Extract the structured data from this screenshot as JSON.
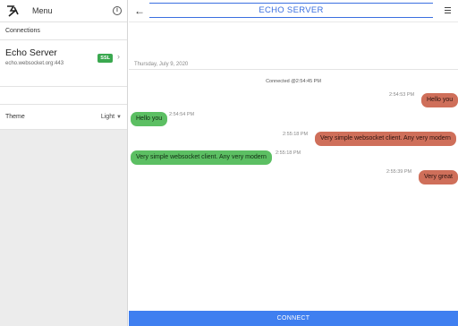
{
  "sidebar": {
    "menu_label": "Menu",
    "connections_label": "Connections",
    "connection": {
      "name": "Echo Server",
      "host": "echo.websocket.org:443",
      "badge": "SSL"
    },
    "theme": {
      "label": "Theme",
      "value": "Light"
    }
  },
  "header": {
    "title": "ECHO SERVER"
  },
  "chat": {
    "date": "Thursday, July 9, 2020",
    "status": "Connected @2:54:45 PM",
    "messages": [
      {
        "direction": "out",
        "text": "Hello you",
        "time": "2:54:53 PM"
      },
      {
        "direction": "in",
        "text": "Hello you",
        "time": "2:54:54 PM"
      },
      {
        "direction": "out",
        "text": "Very simple websocket client. Any very modern",
        "time": "2:55:18 PM"
      },
      {
        "direction": "in",
        "text": "Very simple websocket client. Any very modern",
        "time": "2:55:18 PM"
      },
      {
        "direction": "out",
        "text": "Very great",
        "time": "2:55:39 PM"
      }
    ]
  },
  "footer": {
    "connect_label": "CONNECT"
  },
  "colors": {
    "accent": "#3f7ff0",
    "outgoing": "#cf6f5a",
    "incoming": "#5cbf63",
    "ssl": "#3aa84f"
  }
}
